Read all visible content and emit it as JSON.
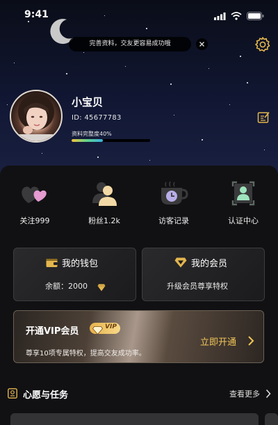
{
  "status_bar": {
    "time": "9:41"
  },
  "profile_tip": {
    "text": "完善资料，交友更容易成功哦"
  },
  "profile": {
    "nickname": "小宝贝",
    "id_text": "ID:  45677783",
    "completeness_label": "资料完整度40%",
    "completeness_fraction": 0.4
  },
  "quick_actions": [
    {
      "label": "关注999",
      "icon": "hearts-icon"
    },
    {
      "label": "粉丝1.2k",
      "icon": "fans-icon"
    },
    {
      "label": "访客记录",
      "icon": "visitor-cup-icon"
    },
    {
      "label": "认证中心",
      "icon": "verify-user-icon"
    }
  ],
  "wallet": {
    "title": "我的钱包",
    "balance_label": "余额：2000",
    "icon": "wallet-icon"
  },
  "membership": {
    "title": "我的会员",
    "subtitle": "升级会员尊享特权",
    "icon": "diamond-icon"
  },
  "vip_banner": {
    "title": "开通VIP会员",
    "badge": "VIP",
    "description": "尊享10项专属特权，提高交友成功率。",
    "action": "立即开通"
  },
  "tasks": {
    "title": "心愿与任务",
    "more": "查看更多"
  },
  "colors": {
    "accent_gold": "#f2c659",
    "background": "#111113",
    "sky": "#111733"
  }
}
